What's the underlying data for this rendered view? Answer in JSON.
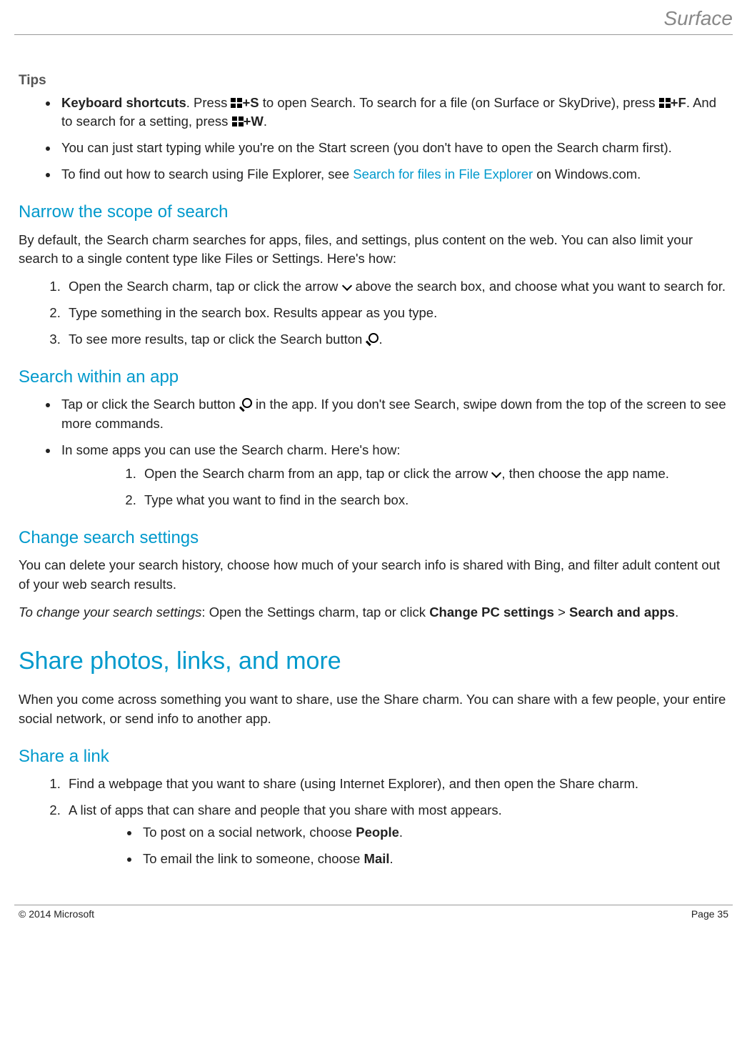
{
  "header": {
    "logo": "Surface"
  },
  "tips": {
    "label": "Tips",
    "items": [
      {
        "b1": "Keyboard shortcuts",
        "t1": ". Press ",
        "k1": "S",
        "t2": " to open Search. To search for a file (on Surface or SkyDrive), press ",
        "k2": "F",
        "t3": ". And to search for a setting, press ",
        "k3": "W",
        "t4": "."
      },
      {
        "text": "You can just start typing while you're on the Start screen (you don't have to open the Search charm first)."
      },
      {
        "pre": "To find out how to search using File Explorer, see ",
        "link": "Search for files in File Explorer",
        "post": " on Windows.com."
      }
    ]
  },
  "narrow": {
    "heading": "Narrow the scope of search",
    "intro": "By default, the Search charm searches for apps, files, and settings, plus content on the web. You can also limit your search to a single content type like Files or Settings. Here's how:",
    "steps": [
      {
        "a": "Open the Search charm, tap or click the arrow ",
        "b": " above the search box, and choose what you want to search for."
      },
      {
        "a": "Type something in the search box. Results appear as you type."
      },
      {
        "a": "To see more results, tap or click the Search button ",
        "b": "."
      }
    ]
  },
  "within": {
    "heading": "Search within an app",
    "bullet1a": "Tap or click the Search button ",
    "bullet1b": " in the app. If you don't see Search, swipe down from the top of the screen to see more commands.",
    "bullet2": "In some apps you can use the Search charm. Here's how:",
    "steps": [
      {
        "a": "Open the Search charm from an app, tap or click the arrow ",
        "b": ", then choose the app name."
      },
      {
        "a": "Type what you want to find in the search box."
      }
    ]
  },
  "change": {
    "heading": "Change search settings",
    "p1": "You can delete your search history, choose how much of your search info is shared with Bing, and filter adult content out of your web search results.",
    "p2_i": "To change your search settings",
    "p2_a": ": Open the Settings charm, tap or click ",
    "p2_b1": "Change PC settings",
    "p2_gt": " > ",
    "p2_b2": "Search and apps",
    "p2_end": "."
  },
  "share": {
    "heading": "Share photos, links, and more",
    "intro": "When you come across something you want to share, use the Share charm. You can share with a few people, your entire social network, or send info to another app."
  },
  "sharelink": {
    "heading": "Share a link",
    "steps": [
      "Find a webpage that you want to share (using Internet Explorer), and then open the Share charm.",
      "A list of apps that can share and people that you share with most appears."
    ],
    "sub": [
      {
        "a": "To post on a social network, choose ",
        "b": "People",
        "c": "."
      },
      {
        "a": "To email the link to someone, choose ",
        "b": "Mail",
        "c": "."
      }
    ]
  },
  "footer": {
    "copyright": "© 2014 Microsoft",
    "page": "Page 35"
  }
}
